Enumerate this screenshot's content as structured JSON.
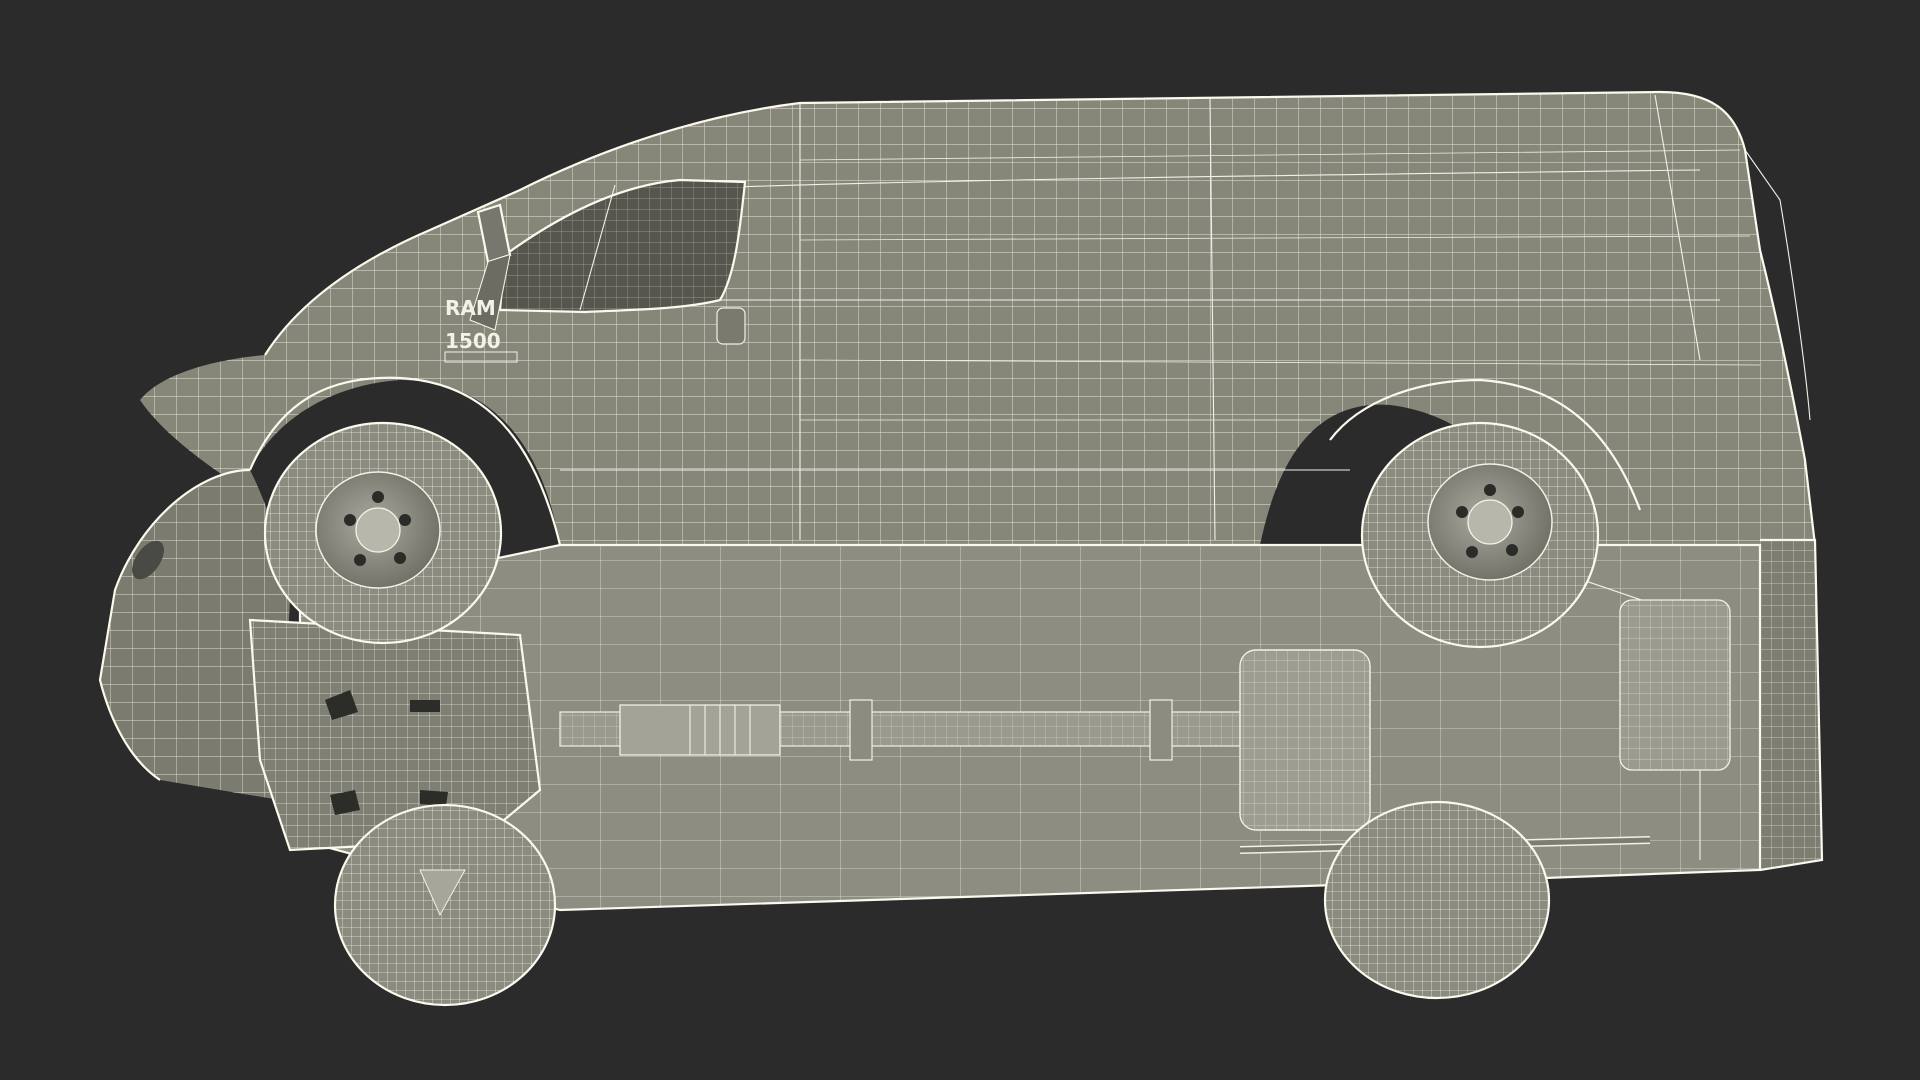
{
  "scene": {
    "background_color": "#2b2b2b",
    "body_color": "#86867b",
    "body_shadow_color": "#6d6d63",
    "underbody_color": "#8c8c81",
    "wire_color": "#f4f1e6",
    "glass_color": "#5c5c56"
  },
  "badge": {
    "line1": "RAM",
    "line2": "1500"
  }
}
